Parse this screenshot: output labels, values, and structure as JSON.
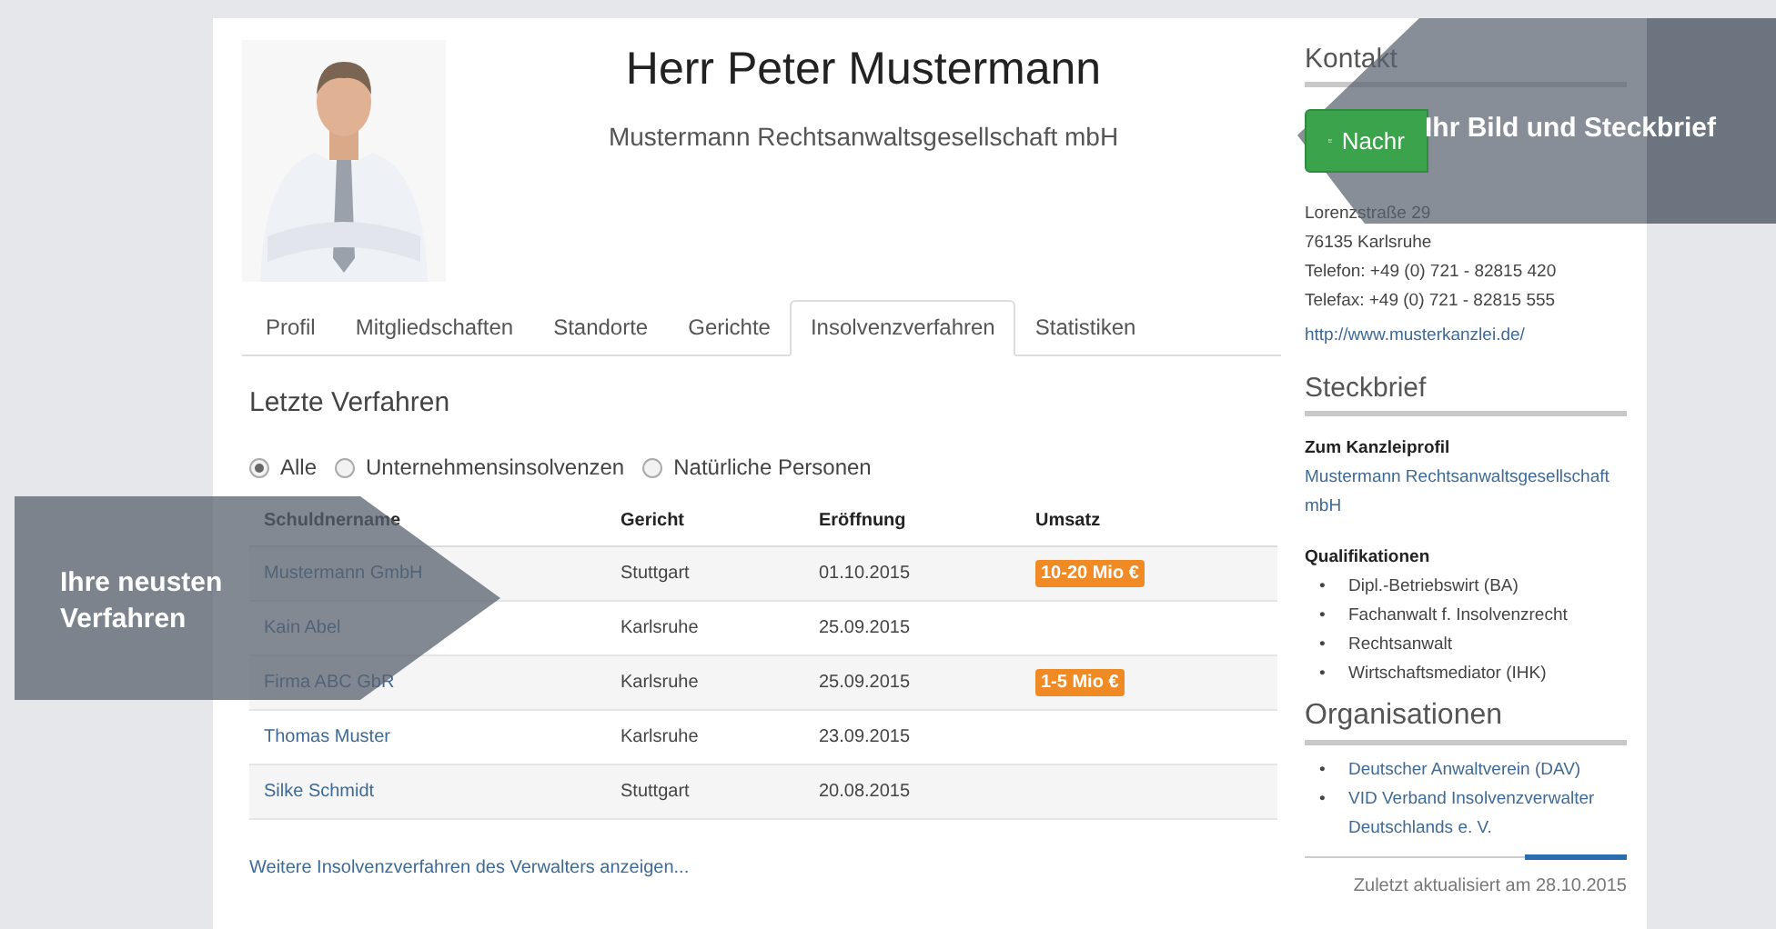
{
  "profile": {
    "name": "Herr Peter Mustermann",
    "firm": "Mustermann Rechtsanwaltsgesellschaft mbH"
  },
  "tabs": [
    {
      "label": "Profil",
      "selected": false
    },
    {
      "label": "Mitgliedschaften",
      "selected": false
    },
    {
      "label": "Standorte",
      "selected": false
    },
    {
      "label": "Gerichte",
      "selected": false
    },
    {
      "label": "Insolvenzverfahren",
      "selected": true
    },
    {
      "label": "Statistiken",
      "selected": false
    }
  ],
  "section_title": "Letzte Verfahren",
  "filters": [
    {
      "label": "Alle",
      "selected": true
    },
    {
      "label": "Unternehmensinsolvenzen",
      "selected": false
    },
    {
      "label": "Natürliche Personen",
      "selected": false
    }
  ],
  "table": {
    "columns": [
      "Schuldnername",
      "Gericht",
      "Eröffnung",
      "Umsatz"
    ],
    "rows": [
      {
        "name": "Mustermann GmbH",
        "court": "Stuttgart",
        "opened": "01.10.2015",
        "revenue": "10-20 Mio €"
      },
      {
        "name": "Kain Abel",
        "court": "Karlsruhe",
        "opened": "25.09.2015"
      },
      {
        "name": "Firma ABC GbR",
        "court": "Karlsruhe",
        "opened": "25.09.2015",
        "revenue": "1-5 Mio €"
      },
      {
        "name": "Thomas Muster",
        "court": "Karlsruhe",
        "opened": "23.09.2015"
      },
      {
        "name": "Silke Schmidt",
        "court": "Stuttgart",
        "opened": "20.08.2015"
      }
    ]
  },
  "more_link": "Weitere Insolvenzverfahren des Verwalters anzeigen...",
  "sidebar": {
    "contact": {
      "title": "Kontakt",
      "button": "Nachr",
      "address_lines": [
        "Lorenzstraße 29",
        "76135 Karlsruhe",
        "Telefon: +49 (0) 721 - 82815 420",
        "Telefax: +49 (0) 721 - 82815 555"
      ],
      "website": "http://www.musterkanzlei.de/"
    },
    "steckbrief": {
      "title": "Steckbrief",
      "profile_heading": "Zum Kanzleiprofil",
      "profile_link": "Mustermann Rechtsanwaltsgesellschaft mbH",
      "qualifications_heading": "Qualifikationen",
      "bullet": "•",
      "qualifications": [
        "Dipl.-Betriebswirt (BA)",
        "Fachanwalt f. Insolvenzrecht",
        "Rechtsanwalt",
        "Wirtschaftsmediator (IHK)"
      ]
    },
    "organisations": {
      "title": "Organisationen",
      "bullet": "•",
      "items": [
        "Deutscher Anwaltverein (DAV)",
        "VID Verband Insolvenzverwalter Deutschlands e. V."
      ]
    },
    "updated": "Zuletzt aktualisiert am 28.10.2015"
  },
  "callouts": [
    {
      "text": "Ihr Bild und Steckbrief"
    },
    {
      "text": "Ihre neusten Verfahren"
    }
  ]
}
